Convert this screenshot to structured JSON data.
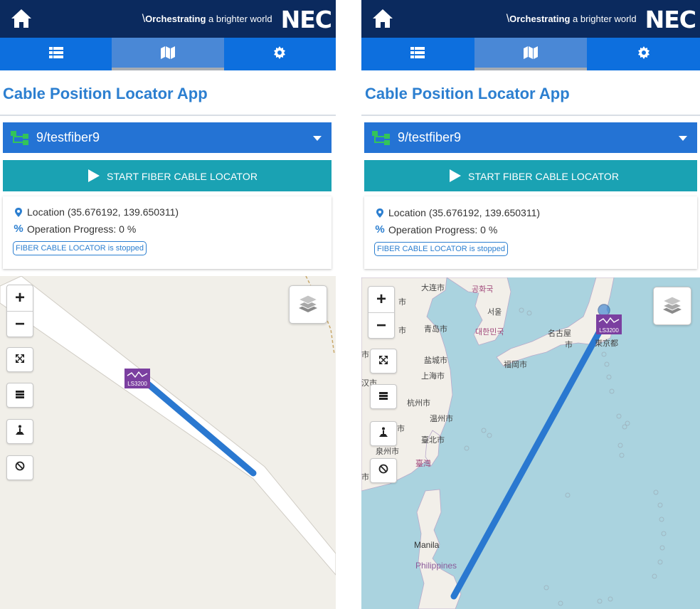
{
  "header": {
    "slogan_bold": "Orchestrating",
    "slogan_rest": " a brighter world",
    "logo": "NEC"
  },
  "tabs": [
    {
      "icon": "list-icon",
      "active": false
    },
    {
      "icon": "map-icon",
      "active": true
    },
    {
      "icon": "gear-icon",
      "active": false
    }
  ],
  "app_title": "Cable Position Locator App",
  "fiber_selector": {
    "value": "9/testfiber9"
  },
  "start_button": {
    "label": "START FIBER CABLE LOCATOR"
  },
  "info": {
    "location": "Location (35.676192, 139.650311)",
    "progress": "Operation Progress: 0 %",
    "status_badge": "FIBER CABLE LOCATOR is stopped"
  },
  "map": {
    "zoom_in": "+",
    "zoom_out": "−",
    "device_label": "LS3200",
    "controls": [
      "fullscreen-icon",
      "menu-icon",
      "person-pin-icon",
      "block-icon"
    ],
    "labels_right": {
      "dalian": "大连市",
      "korea_top": "공화국",
      "seoul": "서울",
      "korea": "대한민국",
      "qingdao": "青岛市",
      "shi1": "市",
      "shi2": "市",
      "shi3": "市",
      "yancheng": "盐城市",
      "nagoya": "名古屋",
      "nagoya2": "市",
      "tokyo": "東京都",
      "fukuoka": "福岡市",
      "shanghai": "上海市",
      "han": "汉市",
      "hangzhou": "杭州市",
      "wenzhou": "温州市",
      "taipei": "臺北市",
      "quanzhou": "泉州市",
      "taiwan": "臺灣",
      "shi4": "市",
      "shi5": "市",
      "manila": "Manila",
      "philippines": "Philippines"
    }
  },
  "colors": {
    "topbar": "#0b2a5e",
    "tabbar": "#0d6fde",
    "selector": "#2473d4",
    "start_button": "#1aa2b3",
    "cable_line": "#2a78d0",
    "device_marker": "#7b3fa0"
  }
}
